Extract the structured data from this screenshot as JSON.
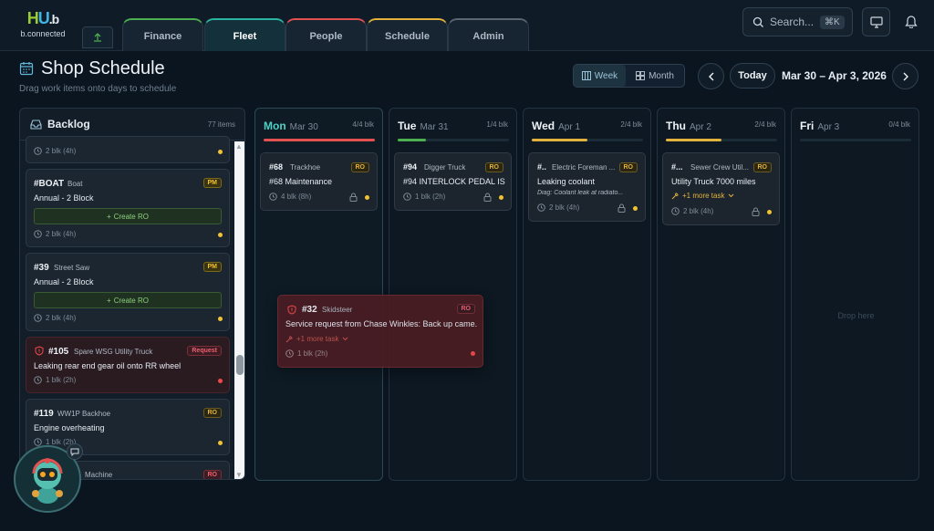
{
  "brand": {
    "name_h": "H",
    "name_u": "U",
    "name_b": ".b",
    "tagline": "b.connected"
  },
  "nav": {
    "tabs": [
      {
        "label": "Finance",
        "color": "#4caf50"
      },
      {
        "label": "Fleet",
        "color": "#2bb5a0"
      },
      {
        "label": "People",
        "color": "#e35050"
      },
      {
        "label": "Schedule",
        "color": "#e3b23c"
      },
      {
        "label": "Admin",
        "color": "#7d8b97"
      }
    ],
    "active_tab": "Fleet"
  },
  "search": {
    "placeholder": "Search...",
    "shortcut": "⌘K"
  },
  "page": {
    "title": "Shop Schedule",
    "subtitle": "Drag work items onto days to schedule"
  },
  "view": {
    "week": "Week",
    "month": "Month",
    "selected": "Week"
  },
  "date_nav": {
    "today": "Today",
    "range": "Mar 30 – Apr 3, 2026"
  },
  "backlog": {
    "title": "Backlog",
    "count": "77 items",
    "cards": [
      {
        "number": "",
        "asset": "",
        "badge": "",
        "title": "",
        "duration": "2 blk (4h)",
        "dot": "yellow"
      },
      {
        "number": "#BOAT",
        "asset": "Boat",
        "badge": "PM",
        "title": "Annual - 2 Block",
        "action": "Create RO",
        "duration": "2 blk (4h)",
        "dot": "yellow"
      },
      {
        "number": "#39",
        "asset": "Street Saw",
        "badge": "PM",
        "title": "Annual - 2 Block",
        "action": "Create RO",
        "duration": "2 blk (4h)",
        "dot": "yellow"
      },
      {
        "number": "#105",
        "asset": "Spare WSG Utility Truck",
        "badge": "Request",
        "title": "Leaking rear end gear oil onto RR wheel",
        "duration": "1 blk (2h)",
        "dot": "red"
      },
      {
        "number": "#119",
        "asset": "WW1P Backhoe",
        "badge": "RO",
        "title": "Engine overheating",
        "duration": "1 blk (2h)",
        "dot": "yellow"
      },
      {
        "number": "",
        "asset": "Machine",
        "badge": "RO",
        "title": "",
        "duration": "",
        "dot": ""
      }
    ]
  },
  "days": [
    {
      "name": "Mon",
      "date": "Mar 30",
      "cap": "4/4 blk",
      "fill": 1.0,
      "color": "#e35050",
      "today": true,
      "card": {
        "number": "#68",
        "asset": "Trackhoe",
        "badge": "RO",
        "title": "#68 Maintenance",
        "duration": "4 blk (8h)"
      }
    },
    {
      "name": "Tue",
      "date": "Mar 31",
      "cap": "1/4 blk",
      "fill": 0.25,
      "color": "#4caf50",
      "today": false,
      "card": {
        "number": "#94",
        "asset": "Digger Truck",
        "badge": "RO",
        "title": "#94 INTERLOCK PEDAL IS...",
        "duration": "1 blk (2h)"
      }
    },
    {
      "name": "Wed",
      "date": "Apr 1",
      "cap": "2/4 blk",
      "fill": 0.5,
      "color": "#e3b23c",
      "today": false,
      "card": {
        "number": "#..",
        "asset": "Electric Foreman ...",
        "badge": "RO",
        "title": "Leaking coolant",
        "diag": "Diag: Coolant leak at radiato...",
        "duration": "2 blk (4h)"
      }
    },
    {
      "name": "Thu",
      "date": "Apr 2",
      "cap": "2/4 blk",
      "fill": 0.5,
      "color": "#e3b23c",
      "today": false,
      "card": {
        "number": "#...",
        "asset": "Sewer Crew Util...",
        "badge": "RO",
        "title": "Utility Truck 7000 miles",
        "more": "+1 more task",
        "duration": "2 blk (4h)"
      }
    },
    {
      "name": "Fri",
      "date": "Apr 3",
      "cap": "0/4 blk",
      "fill": 0,
      "color": "#e3b23c",
      "today": false,
      "drop_text": "Drop here"
    }
  ],
  "dragging": {
    "number": "#32",
    "asset": "Skidsteer",
    "badge": "RO",
    "title": "Service request from Chase Winkles: Back up came...",
    "more": "+1 more task",
    "duration": "1 blk (2h)"
  }
}
